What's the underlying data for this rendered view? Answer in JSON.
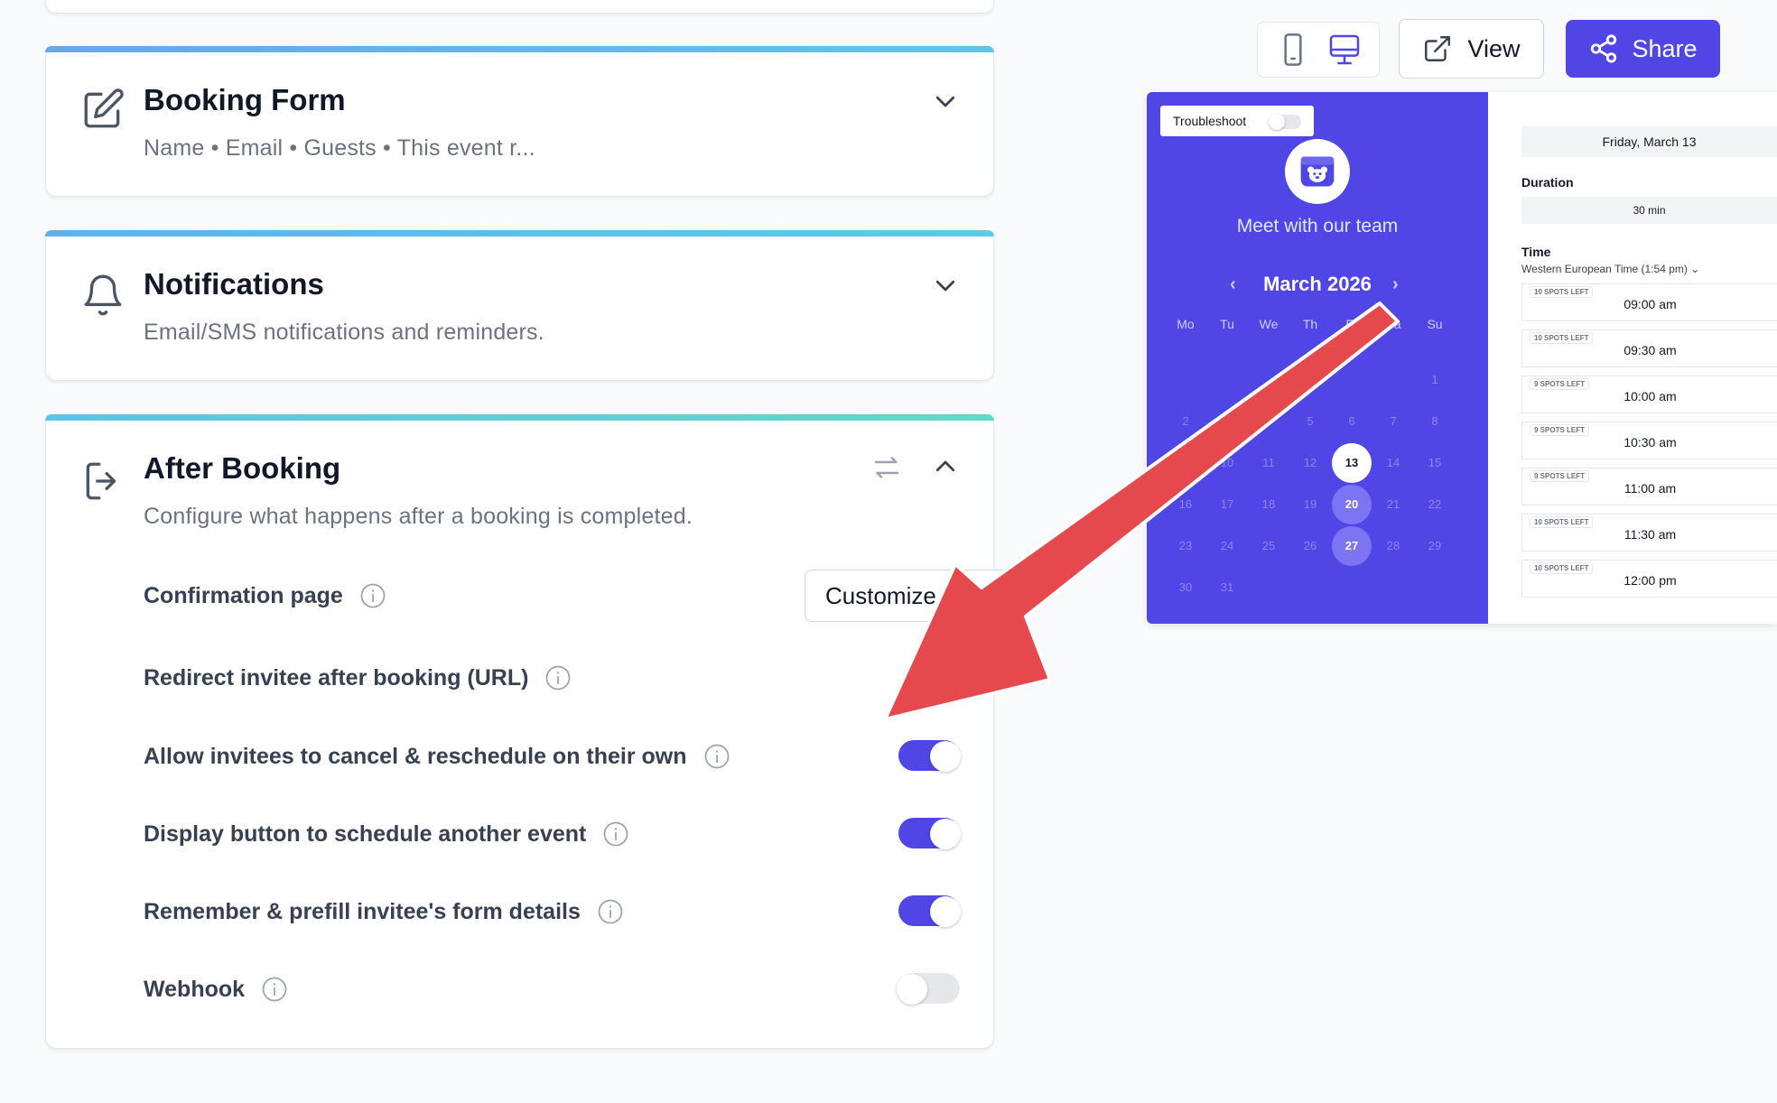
{
  "booking_form": {
    "title": "Booking Form",
    "subtitle": "Name • Email • Guests • This event r..."
  },
  "notifications": {
    "title": "Notifications",
    "subtitle": "Email/SMS notifications and reminders."
  },
  "after_booking": {
    "title": "After Booking",
    "subtitle": "Configure what happens after a booking is completed.",
    "customize_label": "Customize",
    "settings": [
      {
        "label": "Confirmation page"
      },
      {
        "label": "Redirect invitee after booking (URL)"
      },
      {
        "label": "Allow invitees to cancel & reschedule on their own",
        "enabled": true
      },
      {
        "label": "Display button to schedule another event",
        "enabled": true
      },
      {
        "label": "Remember & prefill invitee's form details",
        "enabled": true
      },
      {
        "label": "Webhook",
        "enabled": false
      }
    ]
  },
  "toolbar": {
    "view_label": "View",
    "share_label": "Share"
  },
  "preview": {
    "troubleshoot_label": "Troubleshoot",
    "team_title": "Meet with our team",
    "month_label": "March 2026",
    "weekdays": [
      "Mo",
      "Tu",
      "We",
      "Th",
      "Fr",
      "Sa",
      "Su"
    ],
    "selected_date": "Friday, March 13",
    "duration_label": "Duration",
    "duration_value": "30 min",
    "time_label": "Time",
    "timezone": "Western European Time (1:54 pm)",
    "slots": [
      {
        "spots": "10 SPOTS LEFT",
        "time": "09:00 am"
      },
      {
        "spots": "10 SPOTS LEFT",
        "time": "09:30 am"
      },
      {
        "spots": "9 SPOTS LEFT",
        "time": "10:00 am"
      },
      {
        "spots": "9 SPOTS LEFT",
        "time": "10:30 am"
      },
      {
        "spots": "9 SPOTS LEFT",
        "time": "11:00 am"
      },
      {
        "spots": "10 SPOTS LEFT",
        "time": "11:30 am"
      },
      {
        "spots": "10 SPOTS LEFT",
        "time": "12:00 pm"
      }
    ],
    "days": [
      "1",
      "2",
      "3",
      "4",
      "5",
      "6",
      "7",
      "8",
      "9",
      "10",
      "11",
      "12",
      "13",
      "14",
      "15",
      "16",
      "17",
      "18",
      "19",
      "20",
      "21",
      "22",
      "23",
      "24",
      "25",
      "26",
      "27",
      "28",
      "29",
      "30",
      "31"
    ],
    "selected_day": "13",
    "available_days": [
      "20",
      "27"
    ]
  },
  "colors": {
    "accent": "#4f46e5",
    "arrow": "#e5484d"
  }
}
